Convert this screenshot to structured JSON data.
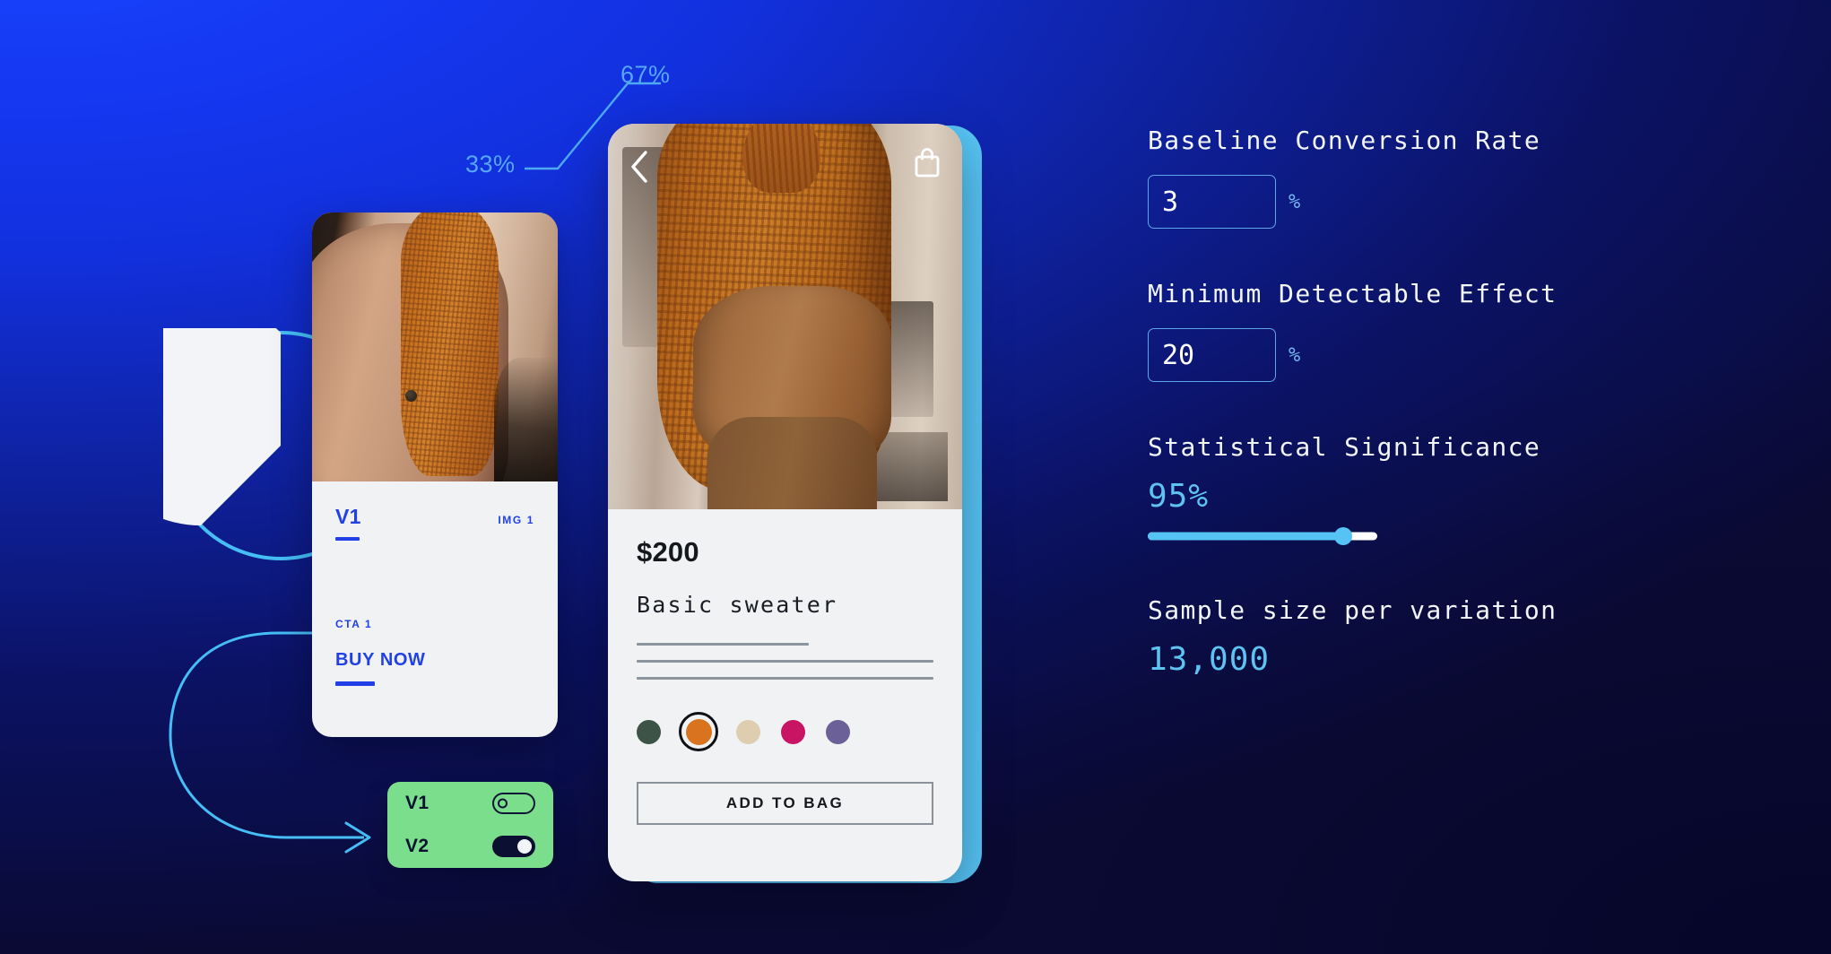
{
  "background": {
    "gradient_from": "#1A46FF",
    "gradient_to": "#0A0A33"
  },
  "split_annotation": {
    "variant_a_pct": "33%",
    "variant_b_pct": "67%",
    "line_color": "#4FA9F0"
  },
  "pie_chart": {
    "segment_label": "67%",
    "fill_color": "#F2F4F8",
    "stroke_color": "#45BDF5"
  },
  "variant_card": {
    "variant_label": "V1",
    "image_tag": "IMG 1",
    "cta_tag": "CTA 1",
    "cta_label": "BUY NOW",
    "accent_color": "#2240E8"
  },
  "toggle_card": {
    "background_color": "#7BDE8C",
    "rows": [
      {
        "label": "V1",
        "state": "off"
      },
      {
        "label": "V2",
        "state": "on"
      }
    ]
  },
  "product_phone": {
    "back_icon": "chevron-left-icon",
    "bag_icon": "shopping-bag-icon",
    "price": "$200",
    "name": "Basic sweater",
    "accent_color": "#57C4F5",
    "swatches": [
      {
        "name": "dark-green",
        "color": "#3D5348",
        "selected": false
      },
      {
        "name": "burnt-orange",
        "color": "#D9731E",
        "selected": true
      },
      {
        "name": "beige",
        "color": "#DFCDB0",
        "selected": false
      },
      {
        "name": "magenta",
        "color": "#C91464",
        "selected": false
      },
      {
        "name": "slate-purple",
        "color": "#6B6098",
        "selected": false
      }
    ],
    "add_to_bag_label": "ADD TO BAG"
  },
  "calculator": {
    "baseline": {
      "label": "Baseline Conversion Rate",
      "value": "3",
      "placeholder": "0",
      "suffix": "%"
    },
    "mde": {
      "label": "Minimum Detectable Effect",
      "value": "20",
      "placeholder": "0",
      "suffix": "%"
    },
    "significance": {
      "label": "Statistical Significance",
      "value": "95%",
      "slider_percent": 85
    },
    "sample_size": {
      "label": "Sample size per variation",
      "value": "13,000"
    },
    "value_color": "#5FC3F2"
  }
}
